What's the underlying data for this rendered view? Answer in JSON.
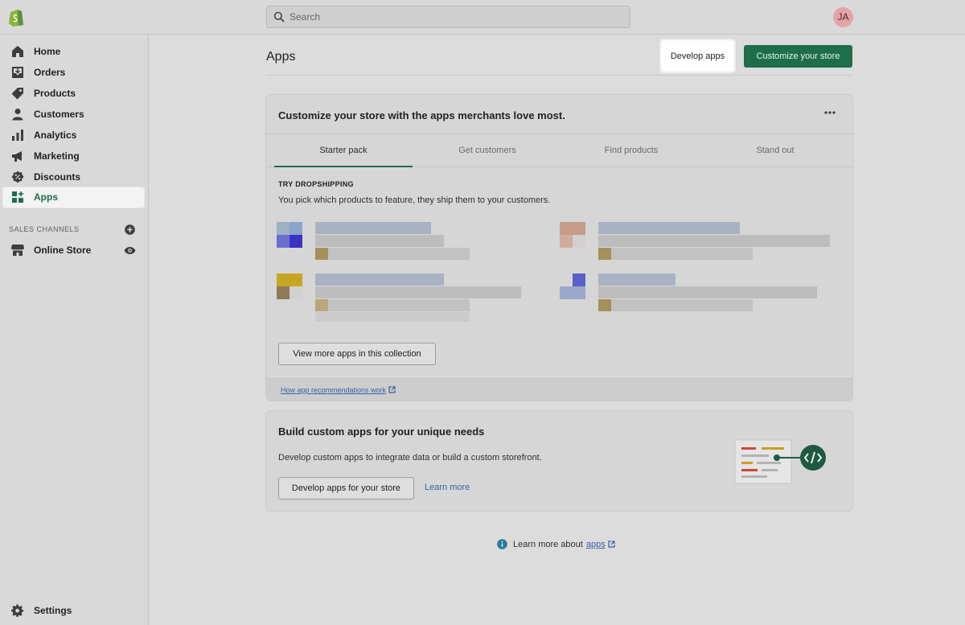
{
  "topbar": {
    "search_placeholder": "Search",
    "avatar_initials": "JA"
  },
  "sidebar": {
    "items": [
      {
        "label": "Home",
        "icon": "home-icon"
      },
      {
        "label": "Orders",
        "icon": "orders-icon"
      },
      {
        "label": "Products",
        "icon": "tag-icon"
      },
      {
        "label": "Customers",
        "icon": "person-icon"
      },
      {
        "label": "Analytics",
        "icon": "bar-chart-icon"
      },
      {
        "label": "Marketing",
        "icon": "megaphone-icon"
      },
      {
        "label": "Discounts",
        "icon": "discount-icon"
      },
      {
        "label": "Apps",
        "icon": "apps-icon",
        "active": true
      }
    ],
    "sales_channels_title": "SALES CHANNELS",
    "online_store_label": "Online Store",
    "settings_label": "Settings"
  },
  "header": {
    "title": "Apps",
    "develop_apps_label": "Develop apps",
    "customize_store_label": "Customize your store"
  },
  "recommendations": {
    "heading": "Customize your store with the apps merchants love most.",
    "tabs": [
      "Starter pack",
      "Get customers",
      "Find products",
      "Stand out"
    ],
    "active_tab": "Starter pack",
    "kicker": "TRY DROPSHIPPING",
    "description": "You pick which products to feature, they ship them to your customers.",
    "view_more_label": "View more apps in this collection",
    "footer_link": "How app recommendations work"
  },
  "custom_apps": {
    "heading": "Build custom apps for your unique needs",
    "description": "Develop custom apps to integrate data or build a custom storefront.",
    "button_label": "Develop apps for your store",
    "learn_more_label": "Learn more"
  },
  "footer": {
    "prefix": "Learn more about",
    "link": "apps"
  },
  "colors": {
    "accent_green": "#1e6e4c",
    "link_blue": "#3a5fa6"
  }
}
